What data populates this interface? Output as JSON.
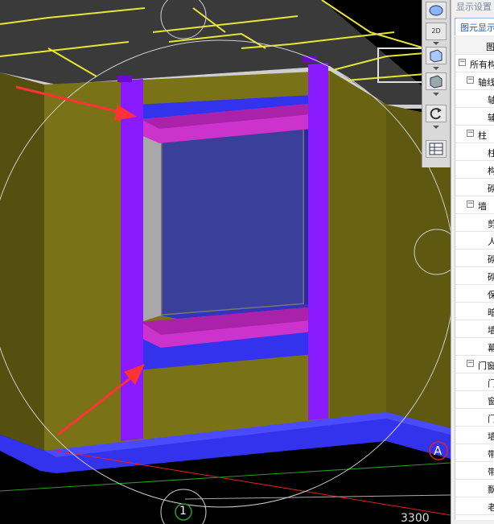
{
  "viewport": {
    "axis_label_a": "A",
    "axis_label_1": "1",
    "dimension_text": "3300"
  },
  "toolbar": {
    "view_2d_label": "2D"
  },
  "panel": {
    "title": "显示设置",
    "tab_label": "图元显示",
    "header_text": "图",
    "tree": [
      {
        "label": "所有构",
        "toggle": "−",
        "level": 0
      },
      {
        "label": "轴线",
        "toggle": "−",
        "level": 1
      },
      {
        "label": "轴",
        "level": 2
      },
      {
        "label": "辅",
        "level": 2
      },
      {
        "label": "柱",
        "toggle": "−",
        "level": 1
      },
      {
        "label": "柱",
        "level": 2
      },
      {
        "label": "构",
        "level": 2
      },
      {
        "label": "砌",
        "level": 2
      },
      {
        "label": "墙",
        "toggle": "−",
        "level": 1
      },
      {
        "label": "剪",
        "level": 2
      },
      {
        "label": "人",
        "level": 2
      },
      {
        "label": "砌",
        "level": 2
      },
      {
        "label": "砌",
        "level": 2
      },
      {
        "label": "保",
        "level": 2
      },
      {
        "label": "暗",
        "level": 2
      },
      {
        "label": "墙",
        "level": 2
      },
      {
        "label": "幕",
        "level": 2
      },
      {
        "label": "门窗",
        "toggle": "−",
        "level": 1
      },
      {
        "label": "门",
        "level": 2
      },
      {
        "label": "窗",
        "level": 2
      },
      {
        "label": "门",
        "level": 2
      },
      {
        "label": "墙",
        "level": 2
      },
      {
        "label": "带",
        "level": 2
      },
      {
        "label": "带",
        "level": 2
      },
      {
        "label": "飘",
        "level": 2
      },
      {
        "label": "老",
        "level": 2
      }
    ]
  },
  "colors": {
    "wall": "#7a7216",
    "wall_dark": "#555010",
    "column": "#8a1aff",
    "beam": "#3333ee",
    "sill": "#cc33cc",
    "glass": "#3a3f9a",
    "arrow": "#ff3333",
    "slab": "#3a3a3a",
    "axis_line": "#ffff33"
  }
}
